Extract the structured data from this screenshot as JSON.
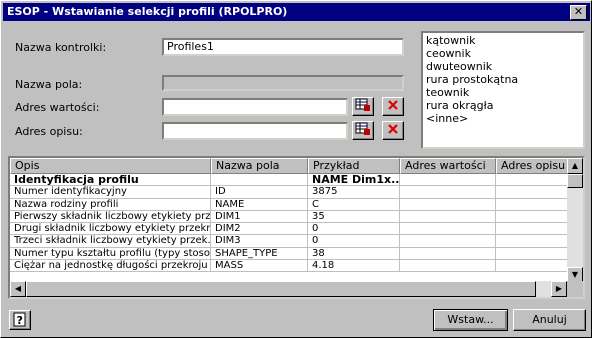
{
  "window": {
    "title": "ESOP - Wstawianie selekcji profili (RPOLPRO)"
  },
  "form": {
    "control_name_label": "Nazwa kontrolki:",
    "control_name_value": "Profiles1",
    "field_name_label": "Nazwa pola:",
    "field_name_value": "",
    "value_address_label": "Adres wartości:",
    "value_address_value": "",
    "desc_address_label": "Adres opisu:",
    "desc_address_value": ""
  },
  "profile_types": [
    "kątownik",
    "ceownik",
    "dwuteownik",
    "rura prostokątna",
    "teownik",
    "rura okrągła",
    "<inne>"
  ],
  "grid": {
    "columns": [
      "Opis",
      "Nazwa pola",
      "Przykład",
      "Adres wartości",
      "Adres opisu"
    ],
    "rows": [
      {
        "opis": "Identyfikacja profilu",
        "nazwa": "",
        "przyklad": "NAME Dim1x...",
        "adres_w": "",
        "adres_o": "",
        "bold": true
      },
      {
        "opis": "Numer identyfikacyjny",
        "nazwa": "ID",
        "przyklad": "3875",
        "adres_w": "",
        "adres_o": ""
      },
      {
        "opis": "Nazwa rodziny profili",
        "nazwa": "NAME",
        "przyklad": "C",
        "adres_w": "",
        "adres_o": ""
      },
      {
        "opis": "Pierwszy składnik liczbowy etykiety prz...",
        "nazwa": "DIM1",
        "przyklad": "35",
        "adres_w": "",
        "adres_o": ""
      },
      {
        "opis": "Drugi składnik liczbowy etykiety przekr...",
        "nazwa": "DIM2",
        "przyklad": "0",
        "adres_w": "",
        "adres_o": ""
      },
      {
        "opis": "Trzeci składnik liczbowy etykiety przek...",
        "nazwa": "DIM3",
        "przyklad": "0",
        "adres_w": "",
        "adres_o": ""
      },
      {
        "opis": "Numer typu kształtu profilu (typy stoso...",
        "nazwa": "SHAPE_TYPE",
        "przyklad": "38",
        "adres_w": "",
        "adres_o": ""
      },
      {
        "opis": "Ciężar na jednostkę długości przekroju",
        "nazwa": "MASS",
        "przyklad": "4.18",
        "adres_w": "",
        "adres_o": ""
      }
    ]
  },
  "buttons": {
    "insert": "Wstaw...",
    "cancel": "Anuluj",
    "help": "?",
    "close": "✕"
  },
  "icons": {
    "pick": "table-pick-icon",
    "clear": "red-x-icon",
    "help": "help-icon"
  }
}
